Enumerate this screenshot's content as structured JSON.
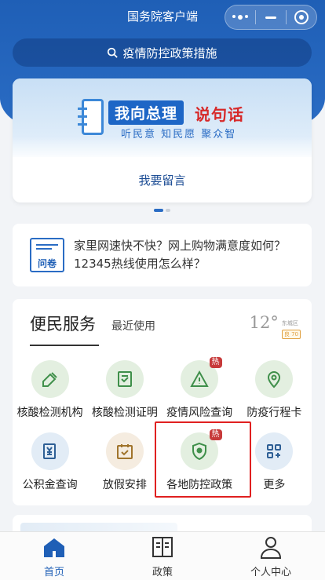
{
  "header": {
    "title": "国务院客户端"
  },
  "search": {
    "placeholder": "疫情防控政策措施"
  },
  "banner": {
    "slogan_part1": "我向总理",
    "slogan_part2": "说句话",
    "sub_slogan": "听民意  知民愿  聚众智",
    "button_label": "我要留言"
  },
  "survey": {
    "icon_label": "问卷",
    "text": "家里网速快不快？网上购物满意度如何？12345热线使用怎么样？"
  },
  "services": {
    "title": "便民服务",
    "recent_tab": "最近使用",
    "weather": {
      "temperature": "12°",
      "location": "东城区",
      "aqi": "良 70"
    },
    "items": [
      {
        "label": "核酸检测机构",
        "icon": "dropper-icon",
        "hot": ""
      },
      {
        "label": "核酸检测证明",
        "icon": "certificate-icon",
        "hot": ""
      },
      {
        "label": "疫情风险查询",
        "icon": "warning-icon",
        "hot": "热"
      },
      {
        "label": "防疫行程卡",
        "icon": "location-pin-icon",
        "hot": ""
      },
      {
        "label": "公积金查询",
        "icon": "yuan-doc-icon",
        "hot": ""
      },
      {
        "label": "放假安排",
        "icon": "calendar-check-icon",
        "hot": ""
      },
      {
        "label": "各地防控政策",
        "icon": "shield-location-icon",
        "hot": "热"
      },
      {
        "label": "更多",
        "icon": "grid-more-icon",
        "hot": ""
      }
    ]
  },
  "tabbar": {
    "items": [
      {
        "label": "首页",
        "icon": "home-icon",
        "active": true
      },
      {
        "label": "政策",
        "icon": "book-icon",
        "active": false
      },
      {
        "label": "个人中心",
        "icon": "user-icon",
        "active": false
      }
    ]
  },
  "colors": {
    "primary": "#1f5fb6",
    "hot_badge": "#c73a3a",
    "highlight_border": "#e02020"
  }
}
